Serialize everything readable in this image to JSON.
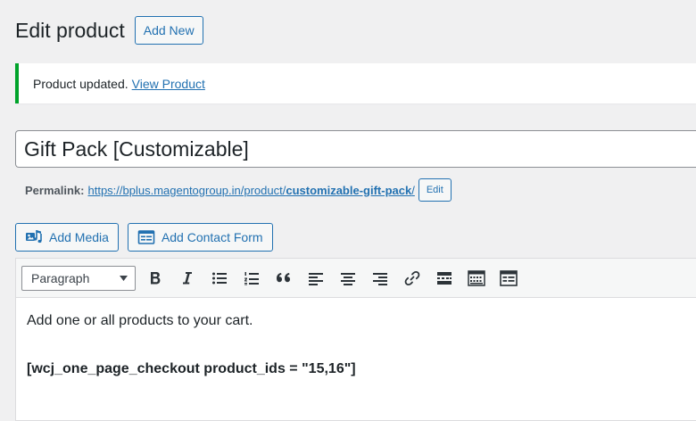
{
  "header": {
    "title": "Edit product",
    "add_new_label": "Add New"
  },
  "notice": {
    "message": "Product updated.",
    "link_text": "View Product",
    "accent_color": "#00a32a"
  },
  "post_title": {
    "value": "Gift Pack [Customizable]"
  },
  "permalink": {
    "label": "Permalink:",
    "url_base": "https://bplus.magentogroup.in/product/",
    "slug": "customizable-gift-pack",
    "url_suffix": "/",
    "edit_label": "Edit"
  },
  "media_buttons": {
    "add_media": "Add Media",
    "add_contact_form": "Add Contact Form"
  },
  "toolbar": {
    "format_selected": "Paragraph",
    "buttons": [
      "bold-icon",
      "italic-icon",
      "bulleted-list-icon",
      "numbered-list-icon",
      "blockquote-icon",
      "align-left-icon",
      "align-center-icon",
      "align-right-icon",
      "insert-link-icon",
      "read-more-icon",
      "toolbar-toggle-icon",
      "form-icon"
    ]
  },
  "content": {
    "line1": "Add one or all products to your cart.",
    "line2": "[wcj_one_page_checkout product_ids = \"15,16\"]"
  },
  "colors": {
    "link": "#2271b1",
    "text": "#1d2327",
    "background": "#f0f0f1"
  }
}
